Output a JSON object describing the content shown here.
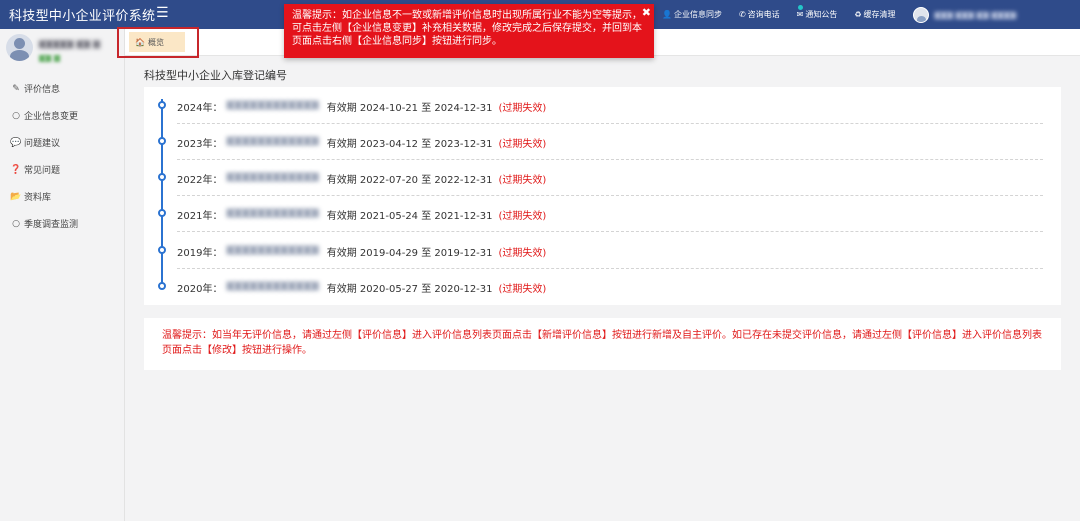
{
  "app": {
    "title": "科技型中小企业评价系统"
  },
  "topnav": {
    "items": [
      {
        "icon": "user-icon",
        "glyph": "👤",
        "label": "企业信息同步"
      },
      {
        "icon": "phone-icon",
        "glyph": "✆",
        "label": "咨询电话"
      },
      {
        "icon": "mail-icon",
        "glyph": "✉",
        "label": "通知公告"
      },
      {
        "icon": "recycle-icon",
        "glyph": "♻",
        "label": "缓存清理"
      }
    ],
    "user_name": "▆▆▆ ▆▆▆ ▆▆ ▆▆▆▆"
  },
  "toast": {
    "text": "温馨提示：如企业信息不一致或新增评价信息时出现所属行业不能为空等提示，可点击左侧【企业信息变更】补充相关数据，修改完成之后保存提交，并回到本页面点击右侧【企业信息同步】按钮进行同步。",
    "close": "✖"
  },
  "profile": {
    "name": "▆▆▆▆▆ ▆▆ ▆",
    "sub": "▆▆ ▆"
  },
  "sidebar": {
    "items": [
      {
        "icon": "edit-icon",
        "glyph": "✎",
        "label": "评价信息"
      },
      {
        "icon": "circle-icon",
        "glyph": "○",
        "label": "企业信息变更"
      },
      {
        "icon": "comment-icon",
        "glyph": "💬",
        "label": "问题建议"
      },
      {
        "icon": "question-icon",
        "glyph": "❓",
        "label": "常见问题"
      },
      {
        "icon": "folder-icon",
        "glyph": "📂",
        "label": "资料库"
      },
      {
        "icon": "circle-icon",
        "glyph": "○",
        "label": "季度调查监测"
      }
    ]
  },
  "tabs": {
    "active": {
      "icon": "home-icon",
      "glyph": "🏠",
      "label": "概览"
    }
  },
  "main": {
    "title": "科技型中小企业入库登记编号",
    "records": [
      {
        "year": "2024年：",
        "code": "▆▆▆▆▆▆▆▆▆▆▆▆",
        "validity": "有效期 2024-10-21 至 2024-12-31",
        "status": "(过期失效)"
      },
      {
        "year": "2023年：",
        "code": "▆▆▆▆▆▆▆▆▆▆▆▆",
        "validity": "有效期 2023-04-12 至 2023-12-31",
        "status": "(过期失效)"
      },
      {
        "year": "2022年：",
        "code": "▆▆▆▆▆▆▆▆▆▆▆▆",
        "validity": "有效期 2022-07-20 至 2022-12-31",
        "status": "(过期失效)"
      },
      {
        "year": "2021年：",
        "code": "▆▆▆▆▆▆▆▆▆▆▆▆",
        "validity": "有效期 2021-05-24 至 2021-12-31",
        "status": "(过期失效)"
      },
      {
        "year": "2019年：",
        "code": "▆▆▆▆▆▆▆▆▆▆▆▆",
        "validity": "有效期 2019-04-29 至 2019-12-31",
        "status": "(过期失效)"
      },
      {
        "year": "2020年：",
        "code": "▆▆▆▆▆▆▆▆▆▆▆▆",
        "validity": "有效期 2020-05-27 至 2020-12-31",
        "status": "(过期失效)"
      }
    ],
    "tip": "温馨提示：如当年无评价信息，请通过左侧【评价信息】进入评价信息列表页面点击【新增评价信息】按钮进行新增及自主评价。如已存在未提交评价信息，请通过左侧【评价信息】进入评价信息列表页面点击【修改】按钮进行操作。"
  },
  "colors": {
    "topbar": "#2f4b8a",
    "toast": "#e4131b",
    "timeline": "#2b73d1",
    "expired": "#e01818",
    "tab_active": "#fbe7c6",
    "highlight_border": "#c7262b"
  }
}
